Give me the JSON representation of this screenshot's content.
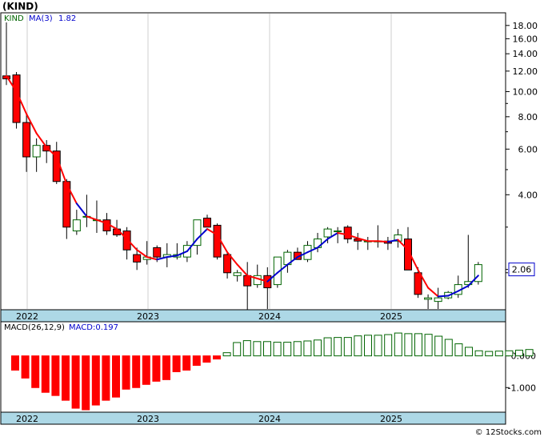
{
  "symbol": "(KIND)",
  "watermark": "© 12Stocks.com",
  "colors": {
    "bear": "#ff0000",
    "bull": "#006400",
    "ma_down": "#ff0000",
    "ma_up": "#0000cc",
    "axis_band": "#add8e6",
    "grid": "#bbbbbb",
    "current_box": "#0000cc"
  },
  "chart_data": [
    {
      "type": "candlestick",
      "panel": "price",
      "legend_symbol": "KIND",
      "legend_ma": "MA(3)",
      "legend_ma_value": "1.82",
      "y_scale": "log",
      "ylim": [
        1.45,
        20
      ],
      "y_ticks": [
        18,
        16,
        14,
        12,
        10,
        8,
        6,
        4
      ],
      "y_tick_labels": [
        "18.00",
        "16.00",
        "14.00",
        "12.00",
        "10.00",
        "8.00",
        "6.00",
        "4.00"
      ],
      "current_value": 2.06,
      "current_label": "2.06",
      "x_tick_labels": [
        "2022",
        "2023",
        "2024",
        "2025"
      ],
      "candles": [
        {
          "o": 11.5,
          "h": 18.5,
          "l": 10.6,
          "c": 11.2
        },
        {
          "o": 11.6,
          "h": 11.9,
          "l": 7.2,
          "c": 7.6
        },
        {
          "o": 7.6,
          "h": 8.2,
          "l": 4.9,
          "c": 5.6
        },
        {
          "o": 5.6,
          "h": 6.6,
          "l": 4.9,
          "c": 6.2
        },
        {
          "o": 6.2,
          "h": 6.5,
          "l": 5.3,
          "c": 5.9
        },
        {
          "o": 5.9,
          "h": 6.4,
          "l": 4.4,
          "c": 4.5
        },
        {
          "o": 4.5,
          "h": 4.6,
          "l": 2.7,
          "c": 3.0
        },
        {
          "o": 2.9,
          "h": 3.5,
          "l": 2.8,
          "c": 3.2
        },
        {
          "o": 3.3,
          "h": 4.0,
          "l": 3.0,
          "c": 3.3
        },
        {
          "o": 3.2,
          "h": 3.8,
          "l": 2.85,
          "c": 3.2
        },
        {
          "o": 3.2,
          "h": 3.4,
          "l": 2.8,
          "c": 2.9
        },
        {
          "o": 2.95,
          "h": 3.2,
          "l": 2.75,
          "c": 2.8
        },
        {
          "o": 2.9,
          "h": 3.0,
          "l": 2.25,
          "c": 2.45
        },
        {
          "o": 2.35,
          "h": 2.5,
          "l": 2.05,
          "c": 2.2
        },
        {
          "o": 2.25,
          "h": 2.65,
          "l": 2.15,
          "c": 2.3
        },
        {
          "o": 2.5,
          "h": 2.55,
          "l": 2.2,
          "c": 2.3
        },
        {
          "o": 2.3,
          "h": 2.6,
          "l": 2.1,
          "c": 2.35
        },
        {
          "o": 2.3,
          "h": 2.6,
          "l": 2.25,
          "c": 2.35
        },
        {
          "o": 2.3,
          "h": 2.65,
          "l": 2.2,
          "c": 2.55
        },
        {
          "o": 2.55,
          "h": 3.2,
          "l": 2.35,
          "c": 3.2
        },
        {
          "o": 3.25,
          "h": 3.35,
          "l": 3.0,
          "c": 3.0
        },
        {
          "o": 3.05,
          "h": 3.1,
          "l": 2.25,
          "c": 2.3
        },
        {
          "o": 2.35,
          "h": 2.4,
          "l": 1.9,
          "c": 2.0
        },
        {
          "o": 1.95,
          "h": 2.05,
          "l": 1.85,
          "c": 2.0
        },
        {
          "o": 1.95,
          "h": 2.2,
          "l": 1.4,
          "c": 1.78
        },
        {
          "o": 1.8,
          "h": 2.15,
          "l": 1.75,
          "c": 1.95
        },
        {
          "o": 1.95,
          "h": 2.1,
          "l": 1.45,
          "c": 1.75
        },
        {
          "o": 1.8,
          "h": 2.3,
          "l": 1.75,
          "c": 2.3
        },
        {
          "o": 2.15,
          "h": 2.45,
          "l": 2.0,
          "c": 2.4
        },
        {
          "o": 2.4,
          "h": 2.5,
          "l": 2.25,
          "c": 2.25
        },
        {
          "o": 2.25,
          "h": 2.65,
          "l": 2.2,
          "c": 2.55
        },
        {
          "o": 2.5,
          "h": 2.85,
          "l": 2.4,
          "c": 2.7
        },
        {
          "o": 2.75,
          "h": 3.0,
          "l": 2.6,
          "c": 2.95
        },
        {
          "o": 2.9,
          "h": 3.0,
          "l": 2.6,
          "c": 2.9
        },
        {
          "o": 3.0,
          "h": 3.05,
          "l": 2.6,
          "c": 2.7
        },
        {
          "o": 2.7,
          "h": 2.85,
          "l": 2.45,
          "c": 2.65
        },
        {
          "o": 2.65,
          "h": 2.75,
          "l": 2.45,
          "c": 2.65
        },
        {
          "o": 2.65,
          "h": 3.05,
          "l": 2.5,
          "c": 2.65
        },
        {
          "o": 2.65,
          "h": 2.75,
          "l": 2.45,
          "c": 2.6
        },
        {
          "o": 2.65,
          "h": 2.95,
          "l": 2.5,
          "c": 2.8
        },
        {
          "o": 2.7,
          "h": 3.0,
          "l": 2.5,
          "c": 2.05
        },
        {
          "o": 2.0,
          "h": 2.1,
          "l": 1.6,
          "c": 1.65
        },
        {
          "o": 1.58,
          "h": 1.65,
          "l": 1.45,
          "c": 1.6
        },
        {
          "o": 1.55,
          "h": 1.75,
          "l": 1.45,
          "c": 1.6
        },
        {
          "o": 1.6,
          "h": 1.7,
          "l": 1.58,
          "c": 1.68
        },
        {
          "o": 1.65,
          "h": 1.95,
          "l": 1.6,
          "c": 1.8
        },
        {
          "o": 1.8,
          "h": 2.8,
          "l": 1.75,
          "c": 1.85
        },
        {
          "o": 1.85,
          "h": 2.2,
          "l": 1.8,
          "c": 2.15
        }
      ],
      "ma3": [
        11.5,
        10.0,
        8.2,
        6.9,
        6.1,
        5.6,
        4.4,
        3.7,
        3.3,
        3.2,
        3.1,
        2.95,
        2.7,
        2.45,
        2.3,
        2.25,
        2.3,
        2.33,
        2.42,
        2.7,
        2.95,
        2.8,
        2.4,
        2.15,
        1.95,
        1.9,
        1.85,
        2.0,
        2.15,
        2.3,
        2.4,
        2.5,
        2.7,
        2.85,
        2.8,
        2.72,
        2.65,
        2.65,
        2.63,
        2.68,
        2.45,
        2.05,
        1.75,
        1.62,
        1.63,
        1.7,
        1.78,
        1.95
      ],
      "ma3_trend": [
        "d",
        "d",
        "d",
        "d",
        "d",
        "d",
        "d",
        "d",
        "u",
        "d",
        "d",
        "d",
        "d",
        "d",
        "d",
        "d",
        "u",
        "u",
        "u",
        "u",
        "u",
        "d",
        "d",
        "d",
        "d",
        "d",
        "d",
        "u",
        "u",
        "u",
        "u",
        "u",
        "u",
        "u",
        "d",
        "d",
        "d",
        "d",
        "d",
        "u",
        "d",
        "d",
        "d",
        "d",
        "u",
        "u",
        "u",
        "u"
      ]
    },
    {
      "type": "bar",
      "panel": "macd",
      "legend_label": "MACD(26,12,9)",
      "legend_value": "MACD:0.197",
      "ylim": [
        -1.75,
        1.05
      ],
      "y_ticks": [
        0,
        -1
      ],
      "y_tick_labels": [
        "0.000",
        "-1.000"
      ],
      "x_tick_labels": [
        "2022",
        "2023",
        "2024",
        "2025"
      ],
      "values": [
        -0.45,
        -0.7,
        -1.0,
        -1.15,
        -1.25,
        -1.4,
        -1.65,
        -1.7,
        -1.55,
        -1.4,
        -1.3,
        -1.05,
        -1.0,
        -0.9,
        -0.8,
        -0.75,
        -0.5,
        -0.45,
        -0.3,
        -0.2,
        -0.1,
        0.1,
        0.42,
        0.48,
        0.45,
        0.45,
        0.43,
        0.43,
        0.45,
        0.47,
        0.5,
        0.57,
        0.58,
        0.58,
        0.63,
        0.65,
        0.65,
        0.67,
        0.72,
        0.7,
        0.7,
        0.68,
        0.62,
        0.52,
        0.38,
        0.27,
        0.16,
        0.14,
        0.15,
        0.16,
        0.18,
        0.2
      ]
    }
  ]
}
